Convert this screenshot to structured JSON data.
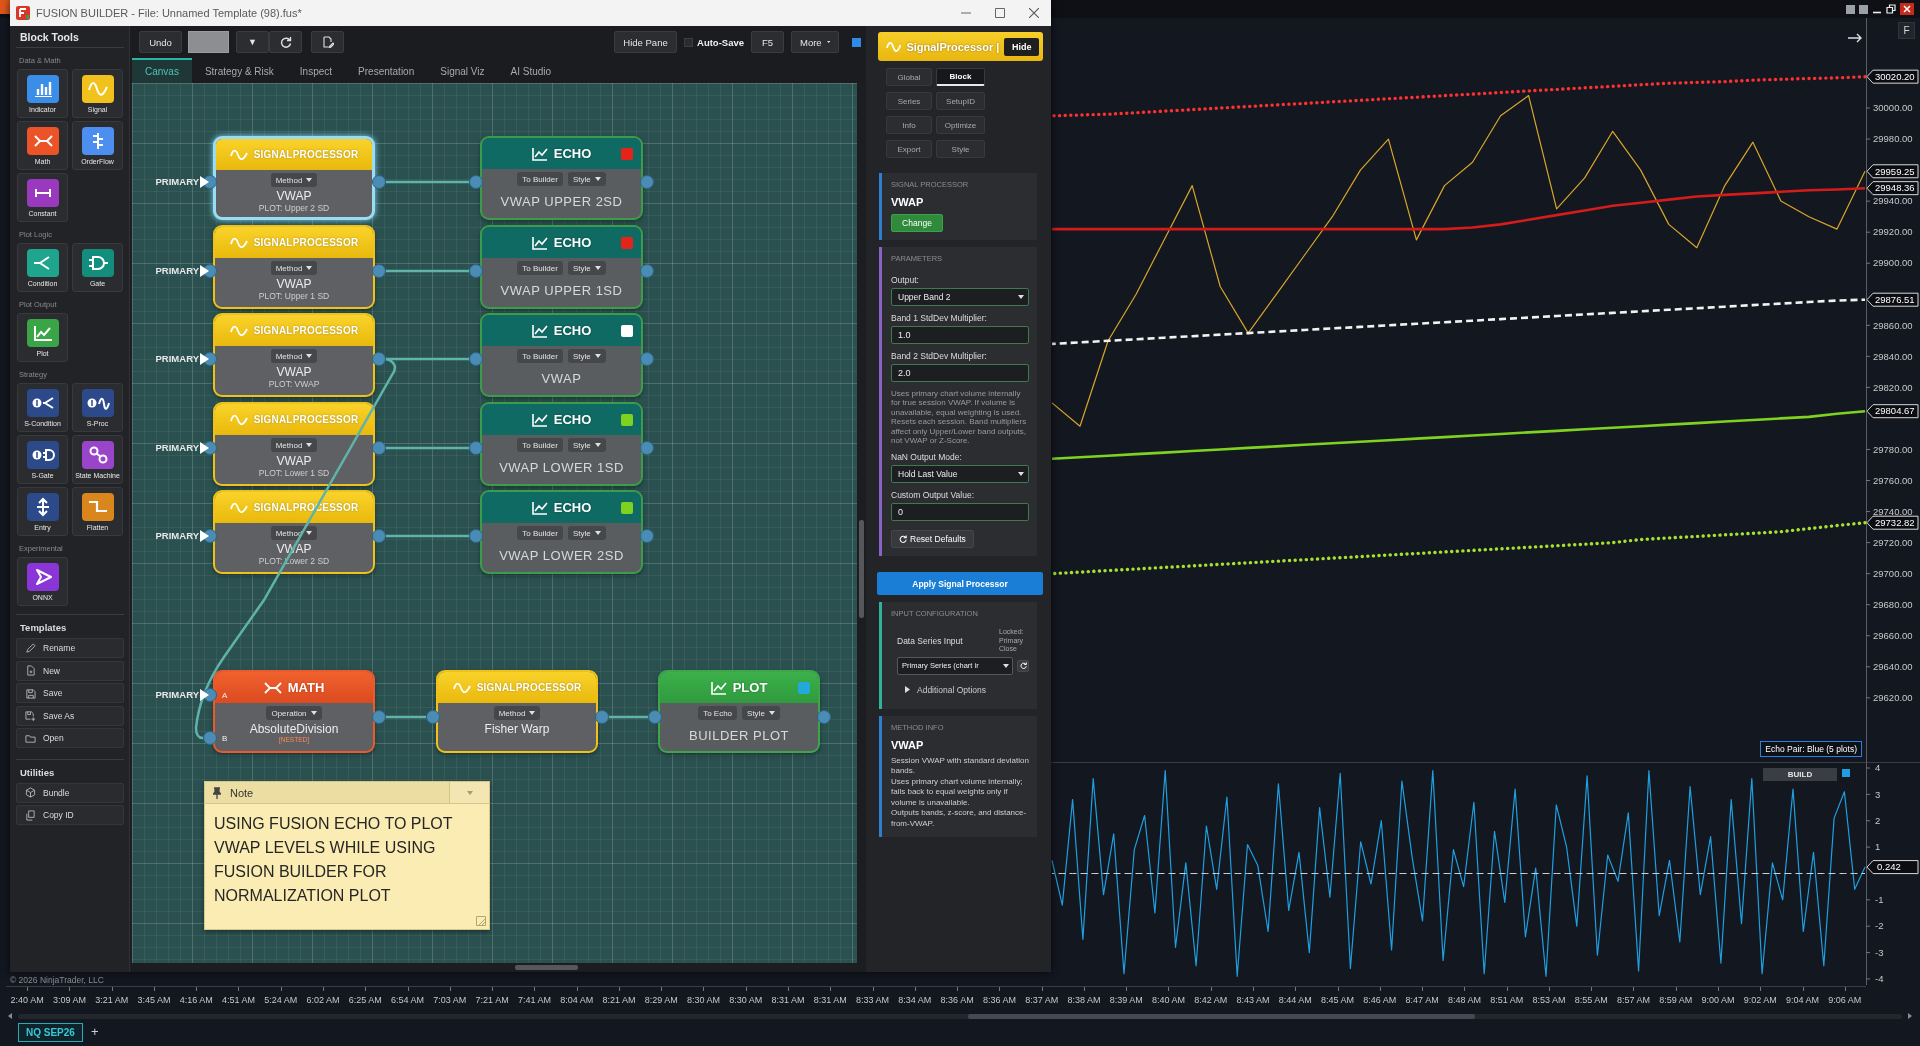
{
  "chart_window": {
    "price_chart": {
      "chart_data": {
        "type": "line",
        "ylim": [
          29578,
          30058
        ],
        "yticks": [
          {
            "value": 30000,
            "label": "30000.00"
          },
          {
            "value": 29980,
            "label": "29980.00"
          },
          {
            "value": 29940,
            "label": "29940.00"
          },
          {
            "value": 29920,
            "label": "29920.00"
          },
          {
            "value": 29900,
            "label": "29900.00"
          },
          {
            "value": 29860,
            "label": "29860.00"
          },
          {
            "value": 29840,
            "label": "29840.00"
          },
          {
            "value": 29820,
            "label": "29820.00"
          },
          {
            "value": 29780,
            "label": "29780.00"
          },
          {
            "value": 29760,
            "label": "29760.00"
          },
          {
            "value": 29740,
            "label": "29740.00"
          },
          {
            "value": 29720,
            "label": "29720.00"
          },
          {
            "value": 29700,
            "label": "29700.00"
          },
          {
            "value": 29680,
            "label": "29680.00"
          },
          {
            "value": 29660,
            "label": "29660.00"
          },
          {
            "value": 29640,
            "label": "29640.00"
          },
          {
            "value": 29620,
            "label": "29620.00"
          }
        ],
        "series": [
          {
            "color": "#ff3030",
            "line_style": "dotted",
            "values": [
              29995,
              29995.5,
              29996,
              29997,
              29998,
              29999,
              30000,
              30001,
              30002,
              30003,
              30004,
              30005,
              30006,
              30007,
              30008,
              30009,
              30010,
              30011,
              30012,
              30013,
              30014,
              30015,
              30016,
              30016.5,
              30017,
              30018,
              30018.5,
              30019,
              30019.5,
              30020.2
            ]
          },
          {
            "color": "#d9a62a",
            "values": [
              29810,
              29795,
              29850,
              29880,
              29915,
              29950,
              29885,
              29855,
              29880,
              29905,
              29930,
              29960,
              29980,
              29915,
              29950,
              29965,
              29995,
              30008,
              29935,
              29955,
              29985,
              29960,
              29925,
              29910,
              29950,
              29978,
              29940,
              29930,
              29922,
              29959.25
            ]
          },
          {
            "color": "#d41c1c",
            "line_style": "solid",
            "values": [
              29922,
              29922,
              29922,
              29922,
              29922,
              29922,
              29922,
              29922,
              29922,
              29922,
              29922,
              29922,
              29922,
              29922,
              29922,
              29923,
              29925,
              29928,
              29931,
              29934,
              29937,
              29939,
              29941,
              29943,
              29944,
              29945,
              29946,
              29947,
              29947.5,
              29948.36
            ]
          },
          {
            "color": "#f2f2f2",
            "line_style": "dashed",
            "values": [
              29848,
              29849,
              29850,
              29851,
              29852,
              29853,
              29854,
              29855,
              29856,
              29857,
              29858,
              29859,
              29860,
              29861,
              29862,
              29863,
              29864,
              29865,
              29866,
              29867,
              29868,
              29869,
              29870,
              29871,
              29872,
              29873,
              29874,
              29875,
              29876,
              29876.51
            ]
          },
          {
            "color": "#7ed321",
            "line_style": "solid",
            "values": [
              29774,
              29775,
              29776,
              29777,
              29778,
              29779,
              29780,
              29781,
              29782,
              29783,
              29784,
              29785,
              29786,
              29787,
              29788,
              29789,
              29790,
              29791,
              29792,
              29793,
              29794,
              29795,
              29796,
              29797,
              29798,
              29799,
              29800,
              29801,
              29803,
              29804.67
            ]
          },
          {
            "color": "#a6e22e",
            "line_style": "dotted",
            "values": [
              29700,
              29701,
              29702,
              29703,
              29704,
              29705,
              29706,
              29707,
              29708,
              29709,
              29710,
              29711,
              29712,
              29713,
              29714,
              29715,
              29716,
              29717,
              29718,
              29719,
              29720,
              29722,
              29723,
              29724,
              29725,
              29726,
              29727,
              29729,
              29731,
              29732.82
            ]
          }
        ]
      },
      "value_labels": [
        "30020.20",
        "29959.25",
        "29948.36",
        "29876.51",
        "29804.67",
        "29732.82"
      ],
      "legend": "Echo Pair: Blue (5 plots)",
      "corner_button": "F"
    },
    "oscillator": {
      "chart_data": {
        "type": "line",
        "ylim": [
          -4.23,
          4.19
        ],
        "yticks": [
          4,
          3,
          2,
          1,
          -1,
          -2,
          -3,
          -4
        ],
        "series": [
          {
            "color": "#1f9ee0",
            "values": [
              0.5,
              -1.2,
              2.8,
              -2.5,
              3.6,
              -0.8,
              1.5,
              -3.8,
              0.9,
              2.2,
              -1.5,
              3.9,
              -2.8,
              0.4,
              -3.5,
              1.8,
              -0.6,
              2.9,
              -3.9,
              1.1,
              0.3,
              -2.2,
              3.4,
              -1.4,
              0.8,
              -3.0,
              2.5,
              -0.9,
              3.8,
              -3.6,
              1.2,
              -0.4,
              2.0,
              -2.9,
              3.5,
              0.6,
              -1.8,
              3.9,
              -3.3,
              0.9,
              -0.5,
              2.7,
              -3.8,
              1.6,
              -1.1,
              3.2,
              -2.4,
              0.2,
              -3.9,
              2.6,
              1.0,
              -2.0,
              3.7,
              -3.1,
              0.7,
              -0.3,
              2.3,
              -3.7,
              3.9,
              -1.6,
              0.5,
              -2.6,
              3.3,
              -0.8,
              1.4,
              -3.4,
              2.8,
              -1.9,
              3.6,
              -3.8,
              0.4,
              -1.0,
              3.2,
              -2.2,
              0.8,
              -3.5,
              2.1,
              3.1,
              -0.6,
              0.242
            ]
          },
          {
            "color": "#d0d0d0",
            "line_style": "dashed",
            "values": [
              0,
              0,
              0,
              0,
              0,
              0,
              0,
              0,
              0,
              0,
              0,
              0,
              0,
              0,
              0,
              0,
              0,
              0,
              0,
              0,
              0,
              0,
              0,
              0,
              0,
              0,
              0,
              0,
              0,
              0,
              0,
              0,
              0,
              0,
              0,
              0,
              0,
              0,
              0,
              0,
              0,
              0,
              0,
              0,
              0,
              0,
              0,
              0,
              0,
              0,
              0,
              0,
              0,
              0,
              0,
              0,
              0,
              0,
              0,
              0,
              0,
              0,
              0,
              0,
              0,
              0,
              0,
              0,
              0,
              0,
              0,
              0,
              0,
              0,
              0,
              0,
              0,
              0,
              0,
              0
            ]
          }
        ]
      },
      "badge": "BUILD",
      "value_label": "0.242"
    },
    "copyright": "© 2026 NinjaTrader, LLC",
    "time_axis": [
      "2:40 AM",
      "3:09 AM",
      "3:21 AM",
      "3:45 AM",
      "4:16 AM",
      "4:51 AM",
      "5:24 AM",
      "6:02 AM",
      "6:25 AM",
      "6:54 AM",
      "7:03 AM",
      "7:21 AM",
      "7:41 AM",
      "8:04 AM",
      "8:21 AM",
      "8:29 AM",
      "8:30 AM",
      "8:30 AM",
      "8:31 AM",
      "8:31 AM",
      "8:33 AM",
      "8:34 AM",
      "8:36 AM",
      "8:36 AM",
      "8:37 AM",
      "8:38 AM",
      "8:39 AM",
      "8:40 AM",
      "8:42 AM",
      "8:43 AM",
      "8:44 AM",
      "8:45 AM",
      "8:46 AM",
      "8:47 AM",
      "8:48 AM",
      "8:51 AM",
      "8:53 AM",
      "8:55 AM",
      "8:57 AM",
      "8:59 AM",
      "9:00 AM",
      "9:02 AM",
      "9:04 AM",
      "9:06 AM"
    ],
    "instrument_tabs": [
      {
        "label": "NQ SEP26",
        "selected": true
      }
    ],
    "add_tab": "+"
  },
  "builder": {
    "title": "FUSION BUILDER - File: Unnamed Template (98).fus*",
    "sidebar": {
      "title": "Block Tools",
      "sections": [
        {
          "label": "Data & Math",
          "tiles": [
            {
              "label": "Indicator",
              "color": "#3a8ee8"
            },
            {
              "label": "Signal",
              "color": "#f1c21b"
            },
            {
              "label": "Math",
              "color": "#ec5428"
            },
            {
              "label": "OrderFlow",
              "color": "#4d8ff0"
            },
            {
              "label": "Constant",
              "color": "#9a39bd"
            }
          ]
        },
        {
          "label": "Plot Logic",
          "tiles": [
            {
              "label": "Condition",
              "color": "#1fa58e"
            },
            {
              "label": "Gate",
              "color": "#138e7d"
            }
          ]
        },
        {
          "label": "Plot Output",
          "tiles": [
            {
              "label": "Plot",
              "color": "#3aa546"
            }
          ]
        },
        {
          "label": "Strategy",
          "tiles": [
            {
              "label": "S-Condition",
              "color": "#2c4a8a"
            },
            {
              "label": "S-Proc",
              "color": "#2c4a8a"
            },
            {
              "label": "S-Gate",
              "color": "#2c4a8a"
            },
            {
              "label": "State Machine",
              "color": "#9a45c9"
            },
            {
              "label": "Entry",
              "color": "#2c4a8a"
            },
            {
              "label": "Flatten",
              "color": "#d9861c"
            }
          ]
        },
        {
          "label": "Experimental",
          "tiles": [
            {
              "label": "ONNX",
              "color": "#8a36d6"
            }
          ]
        }
      ],
      "groups": [
        {
          "title": "Templates",
          "items": [
            "Rename",
            "New",
            "Save",
            "Save As",
            "Open"
          ]
        },
        {
          "title": "Utilities",
          "items": [
            "Bundle",
            "Copy ID"
          ]
        }
      ]
    },
    "toolbar": {
      "undo": "Undo",
      "dropdown": "▼",
      "hide_pane": "Hide Pane",
      "auto_save": {
        "label": "Auto-Save",
        "checked": false
      },
      "refresh": "F5",
      "more": "More"
    },
    "tabs": [
      {
        "label": "Canvas",
        "selected": true
      },
      {
        "label": "Strategy & Risk",
        "selected": false
      },
      {
        "label": "Inspect",
        "selected": false
      },
      {
        "label": "Presentation",
        "selected": false
      },
      {
        "label": "Signal Viz",
        "selected": false
      },
      {
        "label": "AI Studio",
        "selected": false
      }
    ],
    "canvas": {
      "rows": [
        {
          "processor": {
            "input_label": "PRIMARY",
            "title": "SIGNALPROCESSOR",
            "chips": [
              {
                "label": "Method",
                "dropdown": true
              }
            ],
            "value": "VWAP",
            "plot": "PLOT: Upper 2 SD",
            "selected": true,
            "branch_out": false
          },
          "echo": {
            "title": "ECHO",
            "color": "#e4231b",
            "chips": [
              {
                "label": "To Builder",
                "dropdown": false
              },
              {
                "label": "Style",
                "dropdown": true
              }
            ],
            "value": "VWAP UPPER 2SD",
            "selected": false
          }
        },
        {
          "processor": {
            "input_label": "PRIMARY",
            "title": "SIGNALPROCESSOR",
            "chips": [
              {
                "label": "Method",
                "dropdown": true
              }
            ],
            "value": "VWAP",
            "plot": "PLOT: Upper 1 SD",
            "selected": false,
            "branch_out": false
          },
          "echo": {
            "title": "ECHO",
            "color": "#e4231b",
            "chips": [
              {
                "label": "To Builder",
                "dropdown": false
              },
              {
                "label": "Style",
                "dropdown": true
              }
            ],
            "value": "VWAP UPPER 1SD",
            "selected": false
          }
        },
        {
          "processor": {
            "input_label": "PRIMARY",
            "title": "SIGNALPROCESSOR",
            "chips": [
              {
                "label": "Method",
                "dropdown": true
              }
            ],
            "value": "VWAP",
            "plot": "PLOT: VWAP",
            "selected": false,
            "branch_out": true
          },
          "echo": {
            "title": "ECHO",
            "color": "#ffffff",
            "chips": [
              {
                "label": "To Builder",
                "dropdown": false
              },
              {
                "label": "Style",
                "dropdown": true
              }
            ],
            "value": "VWAP",
            "selected": false
          }
        },
        {
          "processor": {
            "input_label": "PRIMARY",
            "title": "SIGNALPROCESSOR",
            "chips": [
              {
                "label": "Method",
                "dropdown": true
              }
            ],
            "value": "VWAP",
            "plot": "PLOT: Lower 1 SD",
            "selected": false,
            "branch_out": false
          },
          "echo": {
            "title": "ECHO",
            "color": "#7ed321",
            "chips": [
              {
                "label": "To Builder",
                "dropdown": false
              },
              {
                "label": "Style",
                "dropdown": true
              }
            ],
            "value": "VWAP LOWER 1SD",
            "selected": false
          }
        },
        {
          "processor": {
            "input_label": "PRIMARY",
            "title": "SIGNALPROCESSOR",
            "chips": [
              {
                "label": "Method",
                "dropdown": true
              }
            ],
            "value": "VWAP",
            "plot": "PLOT: Lower 2 SD",
            "selected": false,
            "branch_out": false
          },
          "echo": {
            "title": "ECHO",
            "color": "#7ed321",
            "chips": [
              {
                "label": "To Builder",
                "dropdown": false
              },
              {
                "label": "Style",
                "dropdown": true
              }
            ],
            "value": "VWAP LOWER 2SD",
            "selected": false
          }
        }
      ],
      "chain": [
        {
          "kind": "math",
          "input_label": "PRIMARY",
          "ports": [
            "A",
            "B"
          ],
          "title": "MATH",
          "chips": [
            {
              "label": "Operation",
              "dropdown": true
            }
          ],
          "value": "AbsoluteDivision",
          "tag": "[NESTED]",
          "selected": false
        },
        {
          "kind": "processor",
          "title": "SIGNALPROCESSOR",
          "chips": [
            {
              "label": "Method",
              "dropdown": true
            }
          ],
          "value": "Fisher Warp",
          "selected": false
        },
        {
          "kind": "plot",
          "title": "PLOT",
          "color": "#22a9d8",
          "chips": [
            {
              "label": "To Echo",
              "dropdown": false
            },
            {
              "label": "Style",
              "dropdown": true
            }
          ],
          "value": "BUILDER PLOT",
          "selected": false
        }
      ],
      "note": {
        "title": "Note",
        "text": "USING FUSION ECHO TO PLOT VWAP LEVELS WHILE USING FUSION BUILDER FOR NORMALIZATION PLOT"
      }
    },
    "inspector": {
      "title": "SignalProcessor |",
      "hide": "Hide",
      "tabs": [
        {
          "label": "Global",
          "selected": false
        },
        {
          "label": "Block",
          "selected": true
        },
        {
          "label": "Series",
          "selected": false
        },
        {
          "label": "SetupID",
          "selected": false
        },
        {
          "label": "Info",
          "selected": false
        },
        {
          "label": "Optimize",
          "selected": false
        },
        {
          "label": "Export",
          "selected": false
        },
        {
          "label": "Style",
          "selected": false
        }
      ],
      "block": {
        "heading": "SIGNAL PROCESSOR",
        "name": "VWAP",
        "action": "Change"
      },
      "parameters": {
        "heading": "PARAMETERS",
        "fields": [
          {
            "kind": "select",
            "label": "Output:",
            "value": "Upper Band 2"
          },
          {
            "kind": "input",
            "label": "Band 1 StdDev Multiplier:",
            "value": "1.0"
          },
          {
            "kind": "input",
            "label": "Band 2 StdDev Multiplier:",
            "value": "2.0"
          },
          {
            "kind": "note",
            "text": "Uses primary chart volume internally for true session VWAP. If volume is unavailable, equal weighting is used. Resets each session. Band multipliers affect only Upper/Lower band outputs, not VWAP or Z-Score."
          },
          {
            "kind": "select",
            "label": "NaN Output Mode:",
            "value": "Hold Last Value"
          },
          {
            "kind": "input",
            "label": "Custom Output Value:",
            "value": "0"
          }
        ],
        "reset": "Reset Defaults"
      },
      "apply": "Apply Signal Processor",
      "input_config": {
        "heading": "INPUT CONFIGURATION",
        "label": "Data Series Input",
        "lock_note": "Locked: Primary Close",
        "select": "Primary Series (chart ir",
        "options_toggle": "Additional Options",
        "expanded": false
      },
      "method_info": {
        "heading": "METHOD INFO",
        "name": "VWAP",
        "paragraphs": [
          "Session VWAP with standard deviation bands.",
          "Uses primary chart volume internally; falls back to equal weights only if volume is unavailable.",
          "Outputs bands, z-score, and distance-from-VWAP."
        ]
      }
    }
  }
}
